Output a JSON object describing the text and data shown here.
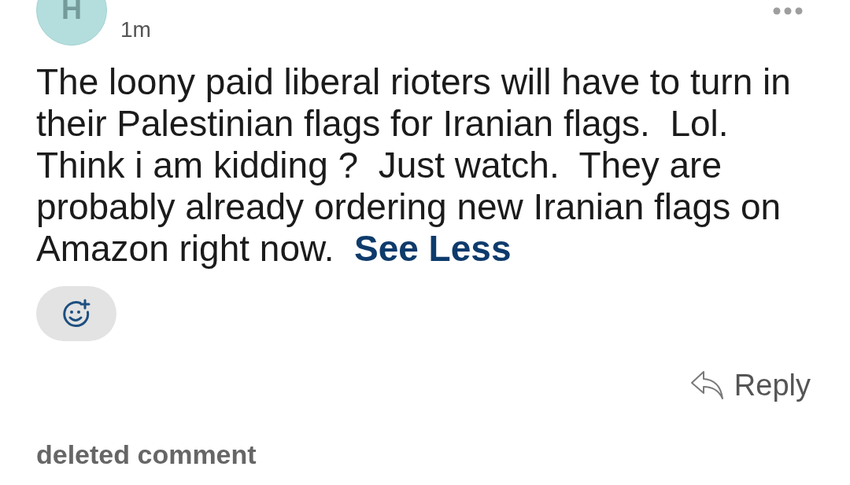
{
  "comment": {
    "avatar": {
      "initial": "H"
    },
    "timestamp": "1m",
    "body": "The loony paid liberal rioters will have to turn in their Palestinian flags for Iranian flags.  Lol.  Think i am kidding ?  Just watch.  They are probably already ordering new Iranian flags on Amazon right now.  ",
    "see_less": "See Less",
    "reply": "Reply"
  },
  "next_comment": {
    "text": "deleted comment"
  }
}
